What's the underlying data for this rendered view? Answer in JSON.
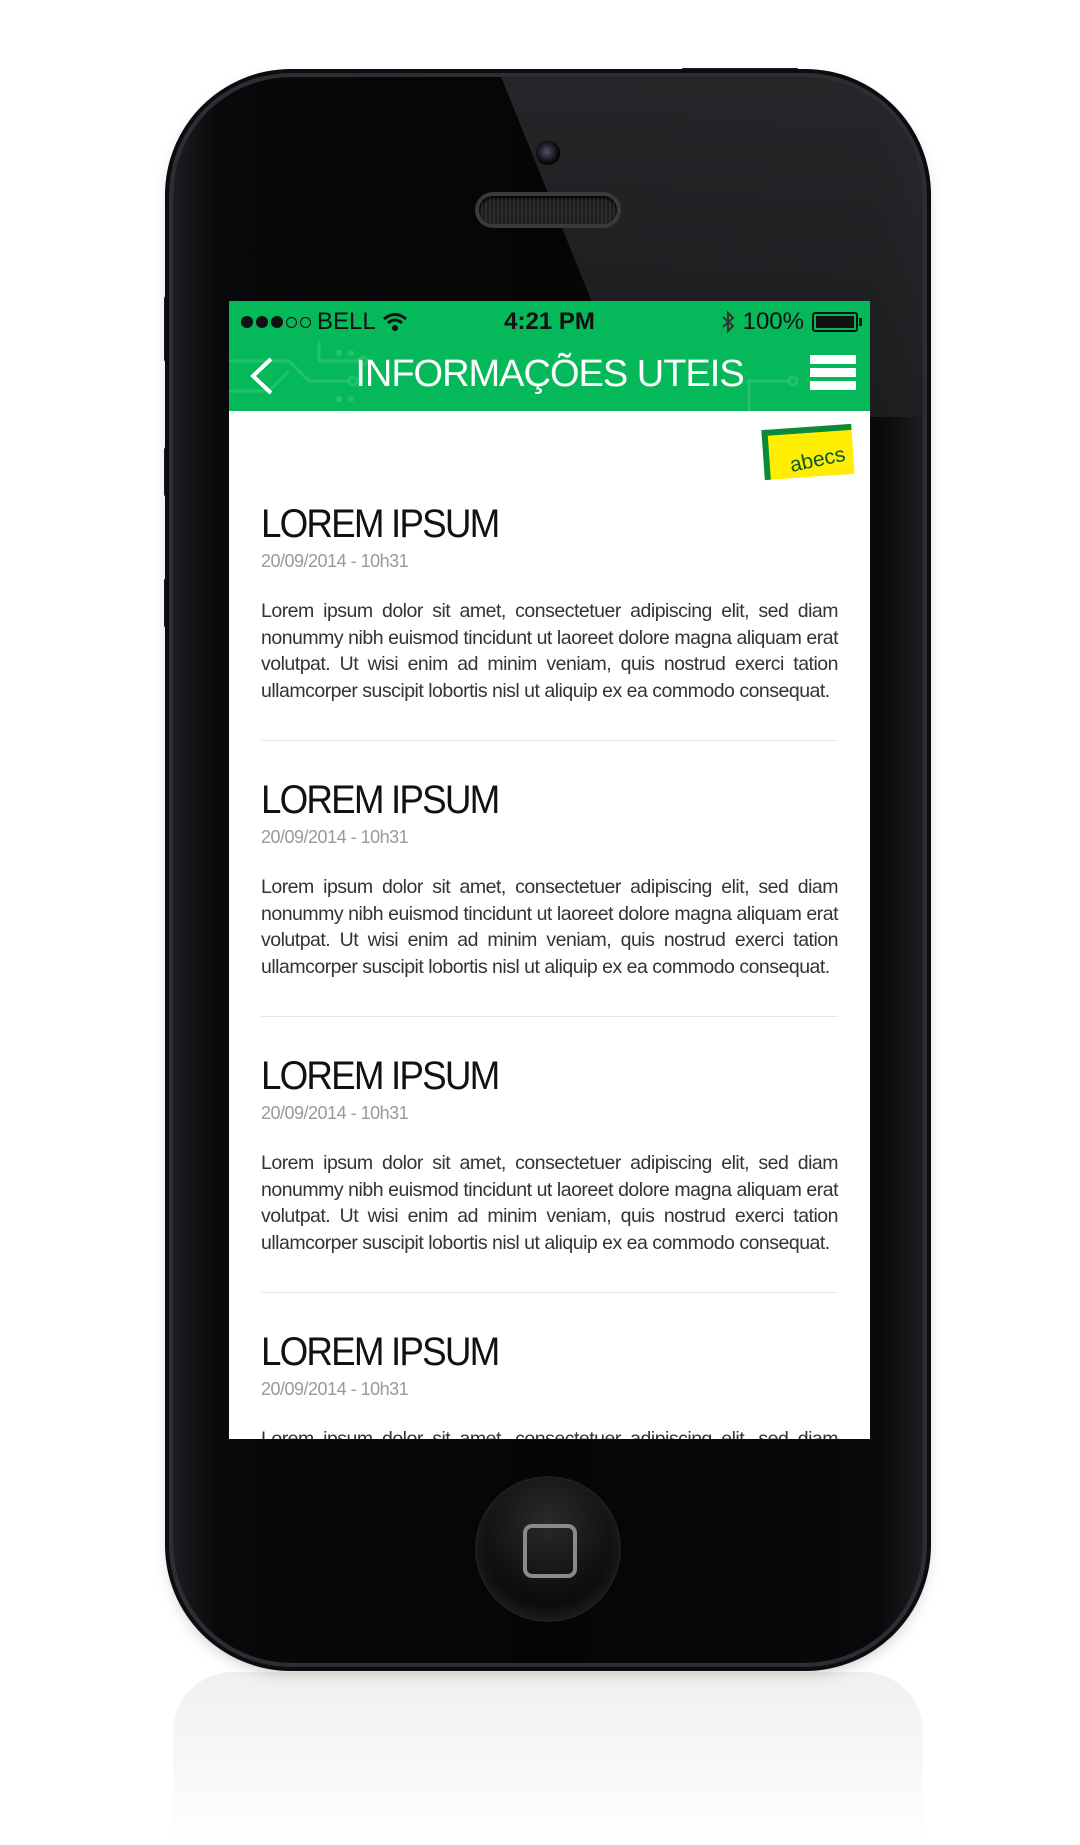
{
  "status_bar": {
    "carrier": "BELL",
    "time": "4:21 PM",
    "battery_percent": "100%",
    "signal_bars_filled": 3,
    "signal_bars_total": 5
  },
  "nav": {
    "title": "INFORMAÇÕES UTEIS",
    "back_icon": "chevron-left-icon",
    "menu_icon": "hamburger-menu-icon",
    "accent_color": "#05b85a"
  },
  "logo": {
    "text": "abecs"
  },
  "articles": [
    {
      "title": "LOREM IPSUM",
      "date": "20/09/2014 - 10h31",
      "body": "Lorem ipsum dolor sit amet, consectetuer adipiscing elit, sed diam nonummy nibh euismod tincidunt ut laoreet dolore magna aliquam erat volutpat. Ut wisi enim ad minim veniam, quis nostrud exerci tation ullamcorper suscipit lobortis nisl ut aliquip ex ea commodo consequat."
    },
    {
      "title": "LOREM IPSUM",
      "date": "20/09/2014 - 10h31",
      "body": "Lorem ipsum dolor sit amet, consectetuer adipiscing elit, sed diam nonummy nibh euismod tincidunt ut laoreet dolore magna aliquam erat volutpat. Ut wisi enim ad minim veniam, quis nostrud exerci tation ullamcorper suscipit lobortis nisl ut aliquip ex ea commodo consequat."
    },
    {
      "title": "LOREM IPSUM",
      "date": "20/09/2014 - 10h31",
      "body": "Lorem ipsum dolor sit amet, consectetuer adipiscing elit, sed diam nonummy nibh euismod tincidunt ut laoreet dolore magna aliquam erat volutpat. Ut wisi enim ad minim veniam, quis nostrud exerci tation ullamcorper suscipit lobortis nisl ut aliquip ex ea commodo consequat."
    },
    {
      "title": "LOREM IPSUM",
      "date": "20/09/2014 - 10h31",
      "body": "Lorem ipsum dolor sit amet, consectetuer adipiscing elit, sed diam nonummy nibh euismod tincidunt ut laoreet dolore magna aliquam erat volutpat. Ut wisi enim ad minim veniam, quis nostrud exerci tation ullamcorper suscipit lobortis nisl ut aliquip ex ea commodo consequat."
    }
  ]
}
